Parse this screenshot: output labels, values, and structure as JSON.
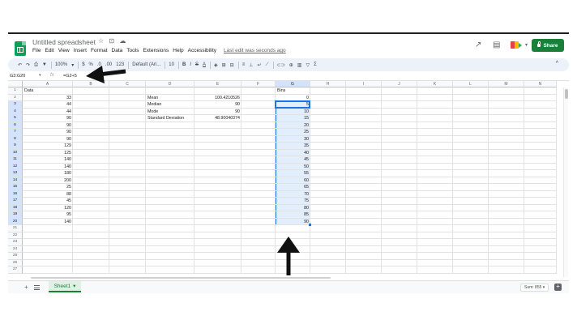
{
  "header": {
    "title": "Untitled spreadsheet",
    "title_icons": "☆ ⊡ ☁",
    "menu": [
      "File",
      "Edit",
      "View",
      "Insert",
      "Format",
      "Data",
      "Tools",
      "Extensions",
      "Help",
      "Accessibility"
    ],
    "last_edit": "Last edit was seconds ago",
    "share_label": "Share",
    "trend_icon": "↗",
    "comment_icon": "▤",
    "meet_caret": "▾"
  },
  "toolbar": {
    "undo": "↶",
    "redo": "↷",
    "print": "⎙",
    "paint": "▼",
    "zoom": "100%",
    "zoom_caret": "▾",
    "currency": "$",
    "percent": "%",
    "dec_less": ".0",
    "dec_more": ".00",
    "num_format": "123",
    "font": "Default (Ari...",
    "font_size": "10",
    "bold": "B",
    "italic": "I",
    "strike": "S",
    "text_color": "A",
    "fill": "◈",
    "borders": "⊞",
    "merge": "⊟",
    "halign": "≡",
    "valign": "⊥",
    "wrap": "↵",
    "rotate": "⟋",
    "link": "⊂⊃",
    "comment": "⊕",
    "chart": "▥",
    "filter": "▽",
    "functions": "Σ",
    "collapse": "^"
  },
  "formula_bar": {
    "name_box": "G3:G20",
    "name_box_caret": "▾",
    "fx": "fx",
    "formula": "=G2+5"
  },
  "columns": [
    "A",
    "B",
    "C",
    "D",
    "E",
    "F",
    "G",
    "H",
    "I",
    "J",
    "K",
    "L",
    "M",
    "N"
  ],
  "rows": [
    "1",
    "2",
    "3",
    "4",
    "5",
    "6",
    "7",
    "8",
    "9",
    "10",
    "11",
    "12",
    "13",
    "14",
    "15",
    "16",
    "17",
    "18",
    "19",
    "20",
    "21",
    "22",
    "23",
    "24",
    "25",
    "26",
    "27"
  ],
  "cells": {
    "a1": "Data",
    "a_values": [
      "33",
      "44",
      "44",
      "90",
      "90",
      "90",
      "90",
      "129",
      "125",
      "140",
      "140",
      "180",
      "200",
      "25",
      "88",
      "45",
      "120",
      "95",
      "140"
    ],
    "stats_labels": [
      "Mean",
      "Median",
      "Mode",
      "Standard Deviation"
    ],
    "stats_values": [
      "100.4210526",
      "90",
      "90",
      "48.90040374"
    ],
    "g1": "Bins",
    "g_values": [
      "0",
      "5",
      "10",
      "15",
      "20",
      "25",
      "30",
      "35",
      "40",
      "45",
      "50",
      "55",
      "60",
      "65",
      "70",
      "75",
      "80",
      "85",
      "90"
    ]
  },
  "bottom": {
    "add_sheet": "+",
    "sheet_name": "Sheet1",
    "sheet_caret": "▾",
    "sum": "Sum: 855",
    "sum_caret": "▾",
    "explore": "+"
  },
  "colors": {
    "brand_green": "#188038",
    "selection_blue": "#1a73e8",
    "selection_fill": "#e8f0fe",
    "toolbar_bg": "#edf2fa"
  }
}
